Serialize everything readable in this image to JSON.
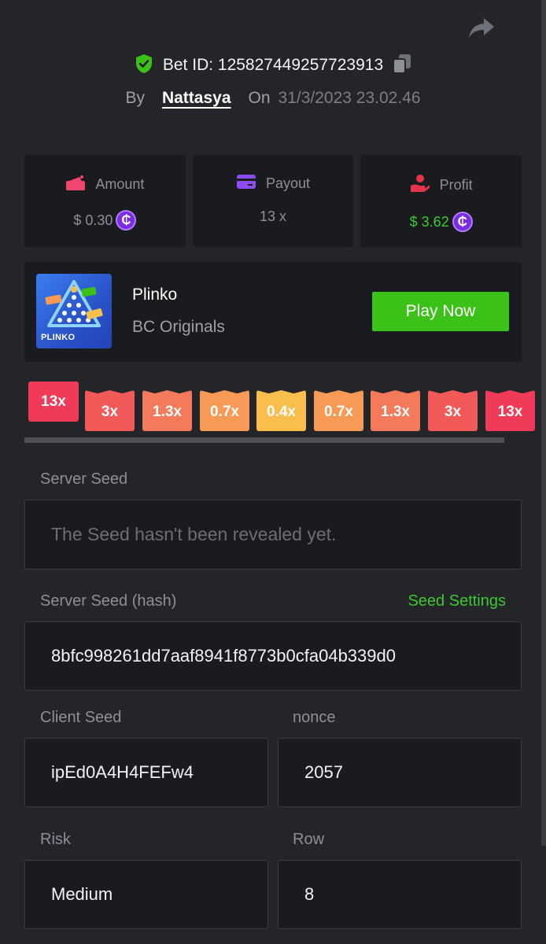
{
  "header": {
    "bet_id": "Bet ID: 125827449257723913",
    "by_label": "By",
    "username": "Nattasya",
    "on_label": "On",
    "date": "31/3/2023 23.02.46"
  },
  "stats": {
    "amount": {
      "label": "Amount",
      "value": "$ 0.30",
      "icon": "wallet-icon"
    },
    "payout": {
      "label": "Payout",
      "value": "13 x",
      "icon": "card-icon"
    },
    "profit": {
      "label": "Profit",
      "value": "$ 3.62",
      "icon": "hand-coin-icon"
    },
    "coin_symbol": "₵"
  },
  "game": {
    "thumb_label": "PLINKO",
    "name": "Plinko",
    "provider": "BC Originals",
    "play_label": "Play Now"
  },
  "multipliers": [
    "13x",
    "3x",
    "1.3x",
    "0.7x",
    "0.4x",
    "0.7x",
    "1.3x",
    "3x",
    "13x"
  ],
  "fields": {
    "server_seed_label": "Server Seed",
    "server_seed_value": "The Seed hasn't been revealed yet.",
    "server_hash_label": "Server Seed (hash)",
    "seed_settings_label": "Seed Settings",
    "server_hash_value": "8bfc998261dd7aaf8941f8773b0cfa04b339d0",
    "client_seed_label": "Client Seed",
    "client_seed_value": "ipEd0A4H4FEFw4",
    "nonce_label": "nonce",
    "nonce_value": "2057",
    "risk_label": "Risk",
    "risk_value": "Medium",
    "row_label": "Row",
    "row_value": "8"
  },
  "colors": {
    "accent_green": "#3bc117",
    "coin_purple": "#7b2be0",
    "multiplier_colors": [
      "#ef3a58",
      "#f25a5a",
      "#f47a5c",
      "#f79a56",
      "#f9be4c",
      "#f79a56",
      "#f47a5c",
      "#f25a5a",
      "#ef3a58"
    ]
  }
}
